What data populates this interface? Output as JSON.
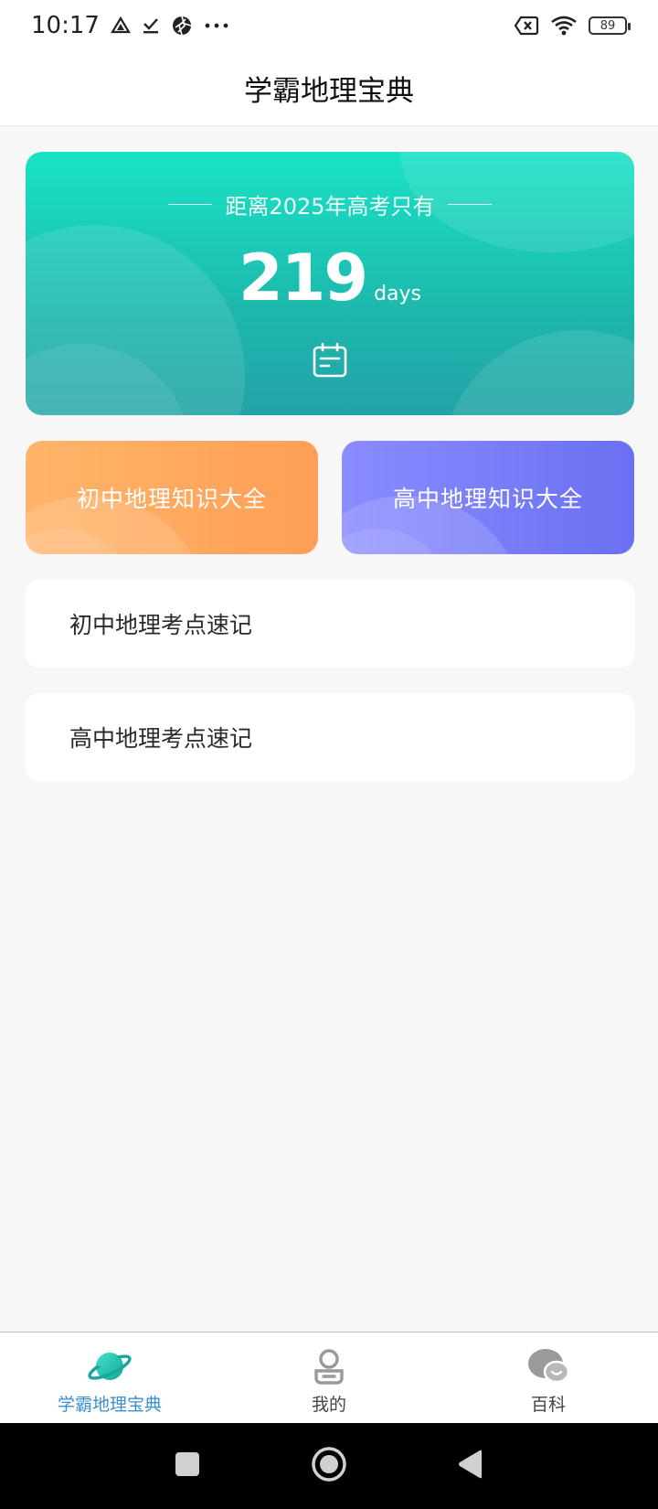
{
  "status_bar": {
    "time": "10:17",
    "battery_level": "89",
    "left_icons": [
      "drive-icon",
      "download-done-icon",
      "aperture-icon",
      "more-dots-icon"
    ],
    "right_icons": [
      "no-sim-icon",
      "wifi-icon",
      "battery-icon"
    ]
  },
  "header": {
    "title": "学霸地理宝典"
  },
  "countdown": {
    "heading": "距离2025年高考只有",
    "days": "219",
    "unit": "days",
    "icon": "calendar-icon",
    "colors": {
      "gradient_top": "#19e3c5",
      "gradient_bottom": "#23a3a7"
    }
  },
  "categories": [
    {
      "label": "初中地理知识大全",
      "color": "#ff9e56"
    },
    {
      "label": "高中地理知识大全",
      "color": "#6a70f2"
    }
  ],
  "list": [
    {
      "label": "初中地理考点速记"
    },
    {
      "label": "高中地理考点速记"
    }
  ],
  "tabbar": {
    "active_color": "#3a8fd0",
    "tabs": [
      {
        "label": "学霸地理宝典",
        "icon": "planet-icon",
        "active": true
      },
      {
        "label": "我的",
        "icon": "person-icon",
        "active": false
      },
      {
        "label": "百科",
        "icon": "chat-bubbles-icon",
        "active": false
      }
    ]
  },
  "system_nav": {
    "buttons": [
      "recents-button",
      "home-button",
      "back-button"
    ]
  }
}
